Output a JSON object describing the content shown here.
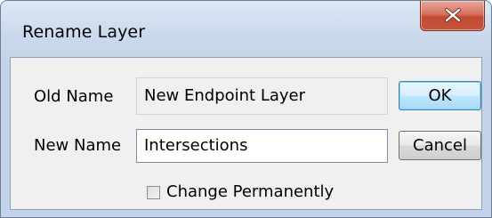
{
  "window": {
    "title": "Rename Layer",
    "close_icon": "close-x-icon"
  },
  "form": {
    "old_name_label": "Old Name",
    "old_name_value": "New Endpoint Layer",
    "new_name_label": "New Name",
    "new_name_value": "Intersections",
    "change_permanently_label": "Change Permanently",
    "change_permanently_checked": false
  },
  "buttons": {
    "ok_label": "OK",
    "cancel_label": "Cancel"
  },
  "colors": {
    "close_button": "#c7533a",
    "default_button_border": "#3c7fb1"
  }
}
